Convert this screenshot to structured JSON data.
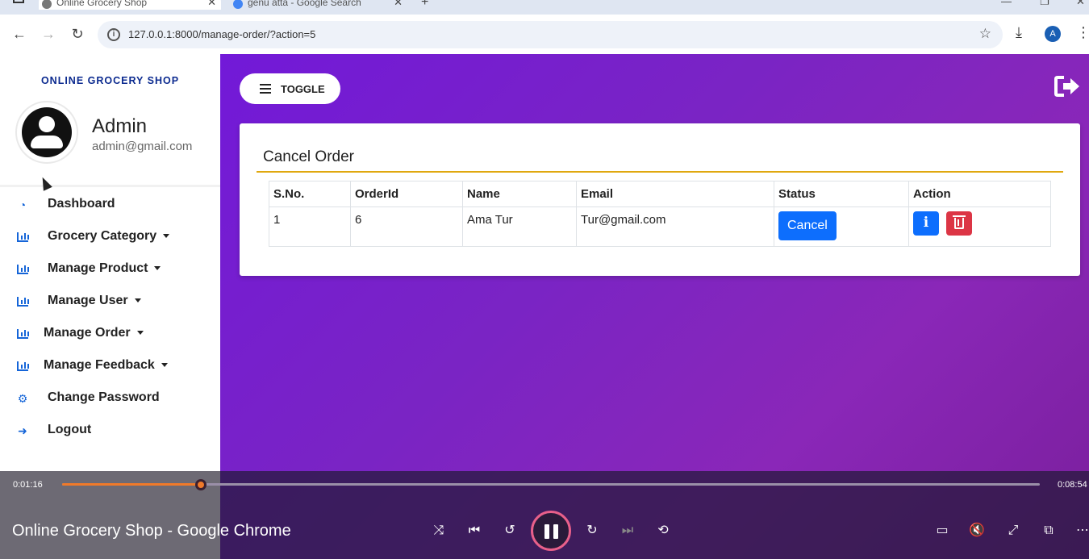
{
  "browser": {
    "tabs": [
      {
        "title": "Online Grocery Shop",
        "active": true
      },
      {
        "title": "genu atta - Google Search",
        "active": false
      }
    ],
    "url": "127.0.0.1:8000/manage-order/?action=5",
    "profile_initial": "A"
  },
  "sidebar": {
    "brand": "ONLINE GROCERY SHOP",
    "user": {
      "name": "Admin",
      "email": "admin@gmail.com"
    },
    "items": [
      {
        "label": "Dashboard",
        "icon": "dashboard-icon",
        "dropdown": false
      },
      {
        "label": "Grocery Category",
        "icon": "chart-bar-icon",
        "dropdown": true
      },
      {
        "label": "Manage Product",
        "icon": "chart-bar-icon",
        "dropdown": true
      },
      {
        "label": "Manage User",
        "icon": "chart-bar-icon",
        "dropdown": true
      },
      {
        "label": "Manage Order",
        "icon": "chart-bar-icon",
        "dropdown": true
      },
      {
        "label": "Manage Feedback",
        "icon": "chart-bar-icon",
        "dropdown": true
      },
      {
        "label": "Change Password",
        "icon": "gear-icon",
        "dropdown": false
      },
      {
        "label": "Logout",
        "icon": "sign-out-icon",
        "dropdown": false
      }
    ]
  },
  "main": {
    "toggle_label": "TOGGLE",
    "card_title": "Cancel Order",
    "table": {
      "headers": [
        "S.No.",
        "OrderId",
        "Name",
        "Email",
        "Status",
        "Action"
      ],
      "rows": [
        {
          "sno": "1",
          "order_id": "6",
          "name": "Ama Tur",
          "email": "Tur@gmail.com",
          "status_button": "Cancel"
        }
      ]
    }
  },
  "player": {
    "elapsed": "0:01:16",
    "total": "0:08:54",
    "progress_fraction": 0.1416,
    "title": "Online Grocery Shop - Google Chrome"
  },
  "colors": {
    "accent_blue": "#0d6efd",
    "danger_red": "#dc3545",
    "gradient_purple": "#7219d8",
    "rule_gold": "#e0a80f",
    "brand_navy": "#0b2a8f"
  }
}
